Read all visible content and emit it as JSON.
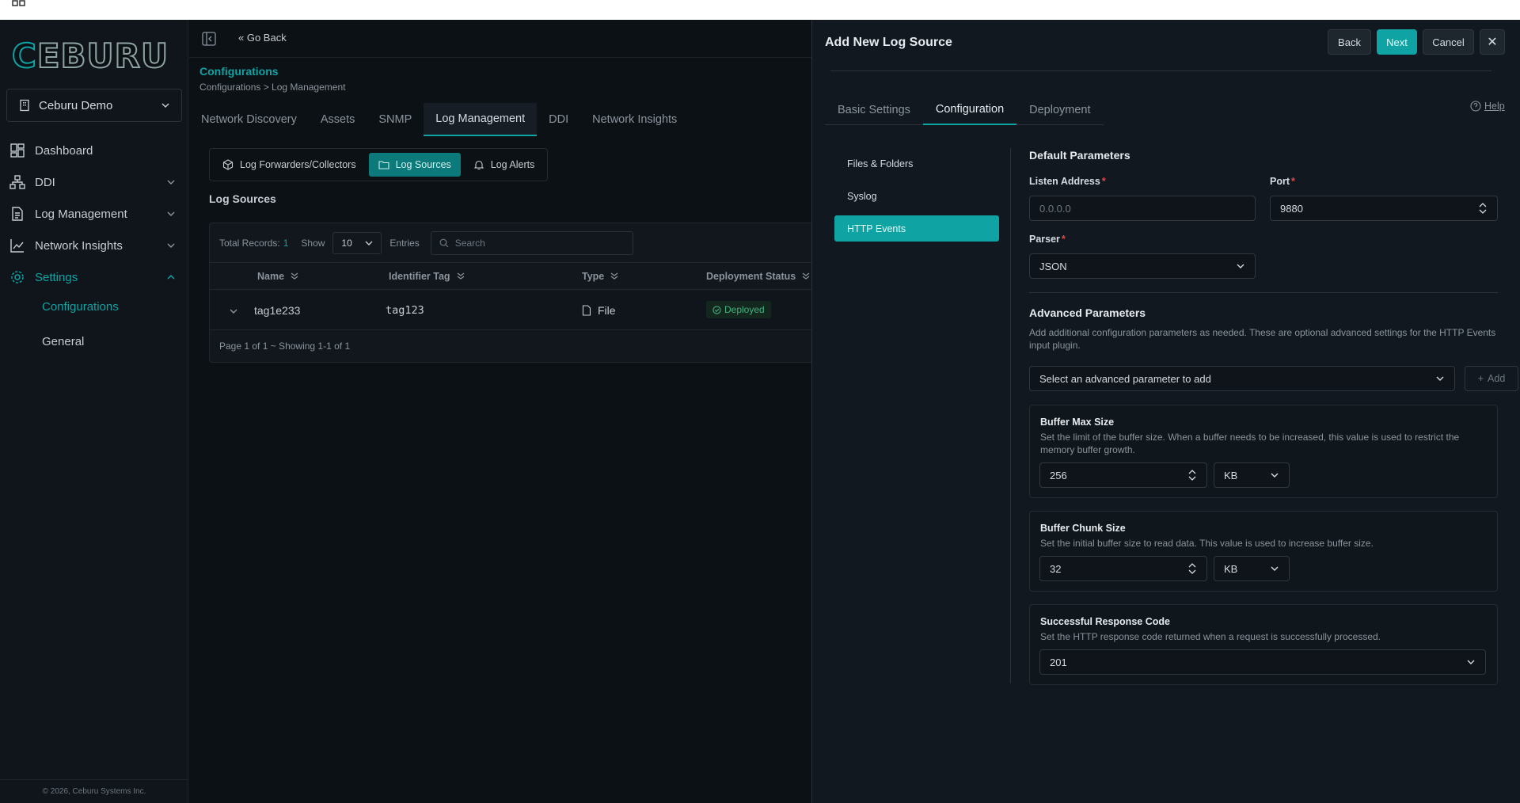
{
  "sidebar": {
    "logo": "CEBURU",
    "org": "Ceburu Demo",
    "nav": [
      {
        "label": "Dashboard"
      },
      {
        "label": "DDI"
      },
      {
        "label": "Log Management"
      },
      {
        "label": "Network Insights"
      },
      {
        "label": "Settings"
      }
    ],
    "sub": [
      "Configurations",
      "General"
    ],
    "footer": "© 2026, Ceburu Systems Inc."
  },
  "main": {
    "go_back": "Go Back",
    "title": "Configurations",
    "breadcrumb": "Configurations > Log Management",
    "tabs": [
      "Network Discovery",
      "Assets",
      "SNMP",
      "Log Management",
      "DDI",
      "Network Insights"
    ],
    "subtabs": [
      "Log Forwarders/Collectors",
      "Log Sources",
      "Log Alerts"
    ],
    "section_title": "Log Sources",
    "table": {
      "total_label": "Total Records:",
      "total": "1",
      "show_label": "Show",
      "page_size": "10",
      "entries_label": "Entries",
      "search_placeholder": "Search",
      "columns": [
        "Name",
        "Identifier Tag",
        "Type",
        "Deployment Status"
      ],
      "rows": [
        {
          "name": "tag1e233",
          "tag": "tag123",
          "type": "File",
          "status": "Deployed"
        }
      ],
      "page_info": "Page 1 of 1 ~ Showing 1-1 of 1"
    }
  },
  "drawer": {
    "title": "Add New Log Source",
    "buttons": {
      "back": "Back",
      "next": "Next",
      "cancel": "Cancel",
      "close": "✕"
    },
    "tabs": [
      "Basic Settings",
      "Configuration",
      "Deployment"
    ],
    "help": "Help",
    "menu": [
      "Files & Folders",
      "Syslog",
      "HTTP Events"
    ],
    "default_params": {
      "title": "Default Parameters",
      "listen_label": "Listen Address",
      "listen_placeholder": "0.0.0.0",
      "port_label": "Port",
      "port_value": "9880",
      "parser_label": "Parser",
      "parser_value": "JSON"
    },
    "advanced": {
      "title": "Advanced Parameters",
      "desc": "Add additional configuration parameters as needed. These are optional advanced settings for the HTTP Events input plugin.",
      "select_placeholder": "Select an advanced parameter to add",
      "add_label": "Add",
      "cards": [
        {
          "title": "Buffer Max Size",
          "desc": "Set the limit of the buffer size. When a buffer needs to be increased, this value is used to restrict the memory buffer growth.",
          "value": "256",
          "unit": "KB"
        },
        {
          "title": "Buffer Chunk Size",
          "desc": "Set the initial buffer size to read data. This value is used to increase buffer size.",
          "value": "32",
          "unit": "KB"
        },
        {
          "title": "Successful Response Code",
          "desc": "Set the HTTP response code returned when a request is successfully processed.",
          "value": "201"
        }
      ]
    }
  },
  "colors": {
    "accent": "#0fa3a3",
    "success": "#3fb27f",
    "required": "#e04a4a"
  }
}
